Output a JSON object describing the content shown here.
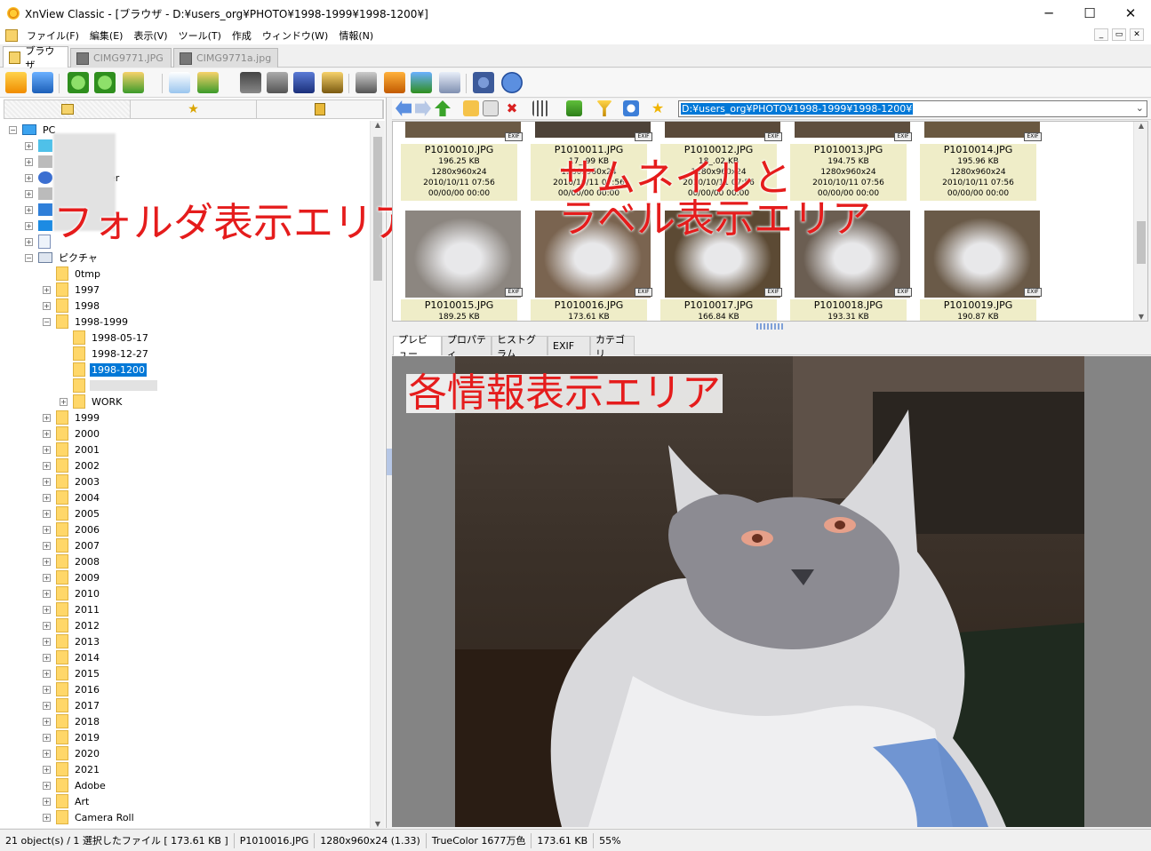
{
  "window": {
    "title": "XnView Classic - [ブラウザ - D:¥users_org¥PHOTO¥1998-1999¥1998-1200¥]",
    "minimize": "─",
    "maximize": "☐",
    "close": "✕"
  },
  "menu": [
    "ファイル(F)",
    "編集(E)",
    "表示(V)",
    "ツール(T)",
    "作成",
    "ウィンドウ(W)",
    "情報(N)"
  ],
  "mdi_buttons": [
    "_",
    "▭",
    "✕"
  ],
  "doc_tabs": [
    {
      "label": "ブラウザ",
      "active": true
    },
    {
      "label": "CIMG9771.JPG",
      "active": false
    },
    {
      "label": "CIMG9771a.jpg",
      "active": false
    }
  ],
  "tree": {
    "root": "PC",
    "pictures": "ピクチャ",
    "folders_level1": [
      "0tmp",
      "1997",
      "1998",
      "1998-1999"
    ],
    "folders_level2": [
      "1998-05-17",
      "1998-12-27",
      "1998-1200"
    ],
    "selected": "1998-1200",
    "work": "WORK",
    "folders_after": [
      "1999",
      "2000",
      "2001",
      "2002",
      "2003",
      "2004",
      "2005",
      "2006",
      "2007",
      "2008",
      "2009",
      "2010",
      "2011",
      "2012",
      "2013",
      "2014",
      "2015",
      "2016",
      "2017",
      "2018",
      "2019",
      "2020",
      "2021",
      "Adobe",
      "Art",
      "Camera Roll"
    ],
    "partial_text": "er"
  },
  "path": "D:¥users_org¥PHOTO¥1998-1999¥1998-1200¥",
  "thumbs_row1": [
    {
      "name": "P1010010.JPG",
      "size": "196.25 KB",
      "dims": "1280x960x24",
      "date": "2010/10/11 07:56",
      "date2": "00/00/00 00:00"
    },
    {
      "name": "P1010011.JPG",
      "size": "17_.99 KB",
      "dims": "1280x960x24",
      "date": "2010/10/11 07:56",
      "date2": "00/00/00 00:00"
    },
    {
      "name": "P1010012.JPG",
      "size": "18_.02 KB",
      "dims": "1280x960x24",
      "date": "2010/10/11 07:56",
      "date2": "00/00/00 00:00"
    },
    {
      "name": "P1010013.JPG",
      "size": "194.75 KB",
      "dims": "1280x960x24",
      "date": "2010/10/11 07:56",
      "date2": "00/00/00 00:00"
    },
    {
      "name": "P1010014.JPG",
      "size": "195.96 KB",
      "dims": "1280x960x24",
      "date": "2010/10/11 07:56",
      "date2": "00/00/00 00:00"
    }
  ],
  "thumbs_row2": [
    {
      "name": "P1010015.JPG",
      "size": "189.25 KB"
    },
    {
      "name": "P1010016.JPG",
      "size": "173.61 KB"
    },
    {
      "name": "P1010017.JPG",
      "size": "166.84 KB"
    },
    {
      "name": "P1010018.JPG",
      "size": "193.31 KB"
    },
    {
      "name": "P1010019.JPG",
      "size": "190.87 KB"
    }
  ],
  "exif_badge": "EXIF",
  "info_tabs": [
    "プレビュー",
    "プロパティ",
    "ヒストグラム",
    "EXIF",
    "カテゴリ"
  ],
  "status": [
    "21 object(s) / 1 選択したファイル [ 173.61 KB ]",
    "P1010016.JPG",
    "1280x960x24 (1.33)",
    "TrueColor 1677万色",
    "173.61 KB",
    "55%"
  ],
  "annotations": {
    "folder_area": "フォルダ表示エリア",
    "thumb_area_1": "サムネイルと",
    "thumb_area_2": "ラベル表示エリア",
    "info_area": "各情報表示エリア"
  },
  "colors": {
    "selection": "#0078d7",
    "annotation": "#e51c1c",
    "thumb_label_bg": "#efedc8",
    "folder": "#ffd769"
  }
}
